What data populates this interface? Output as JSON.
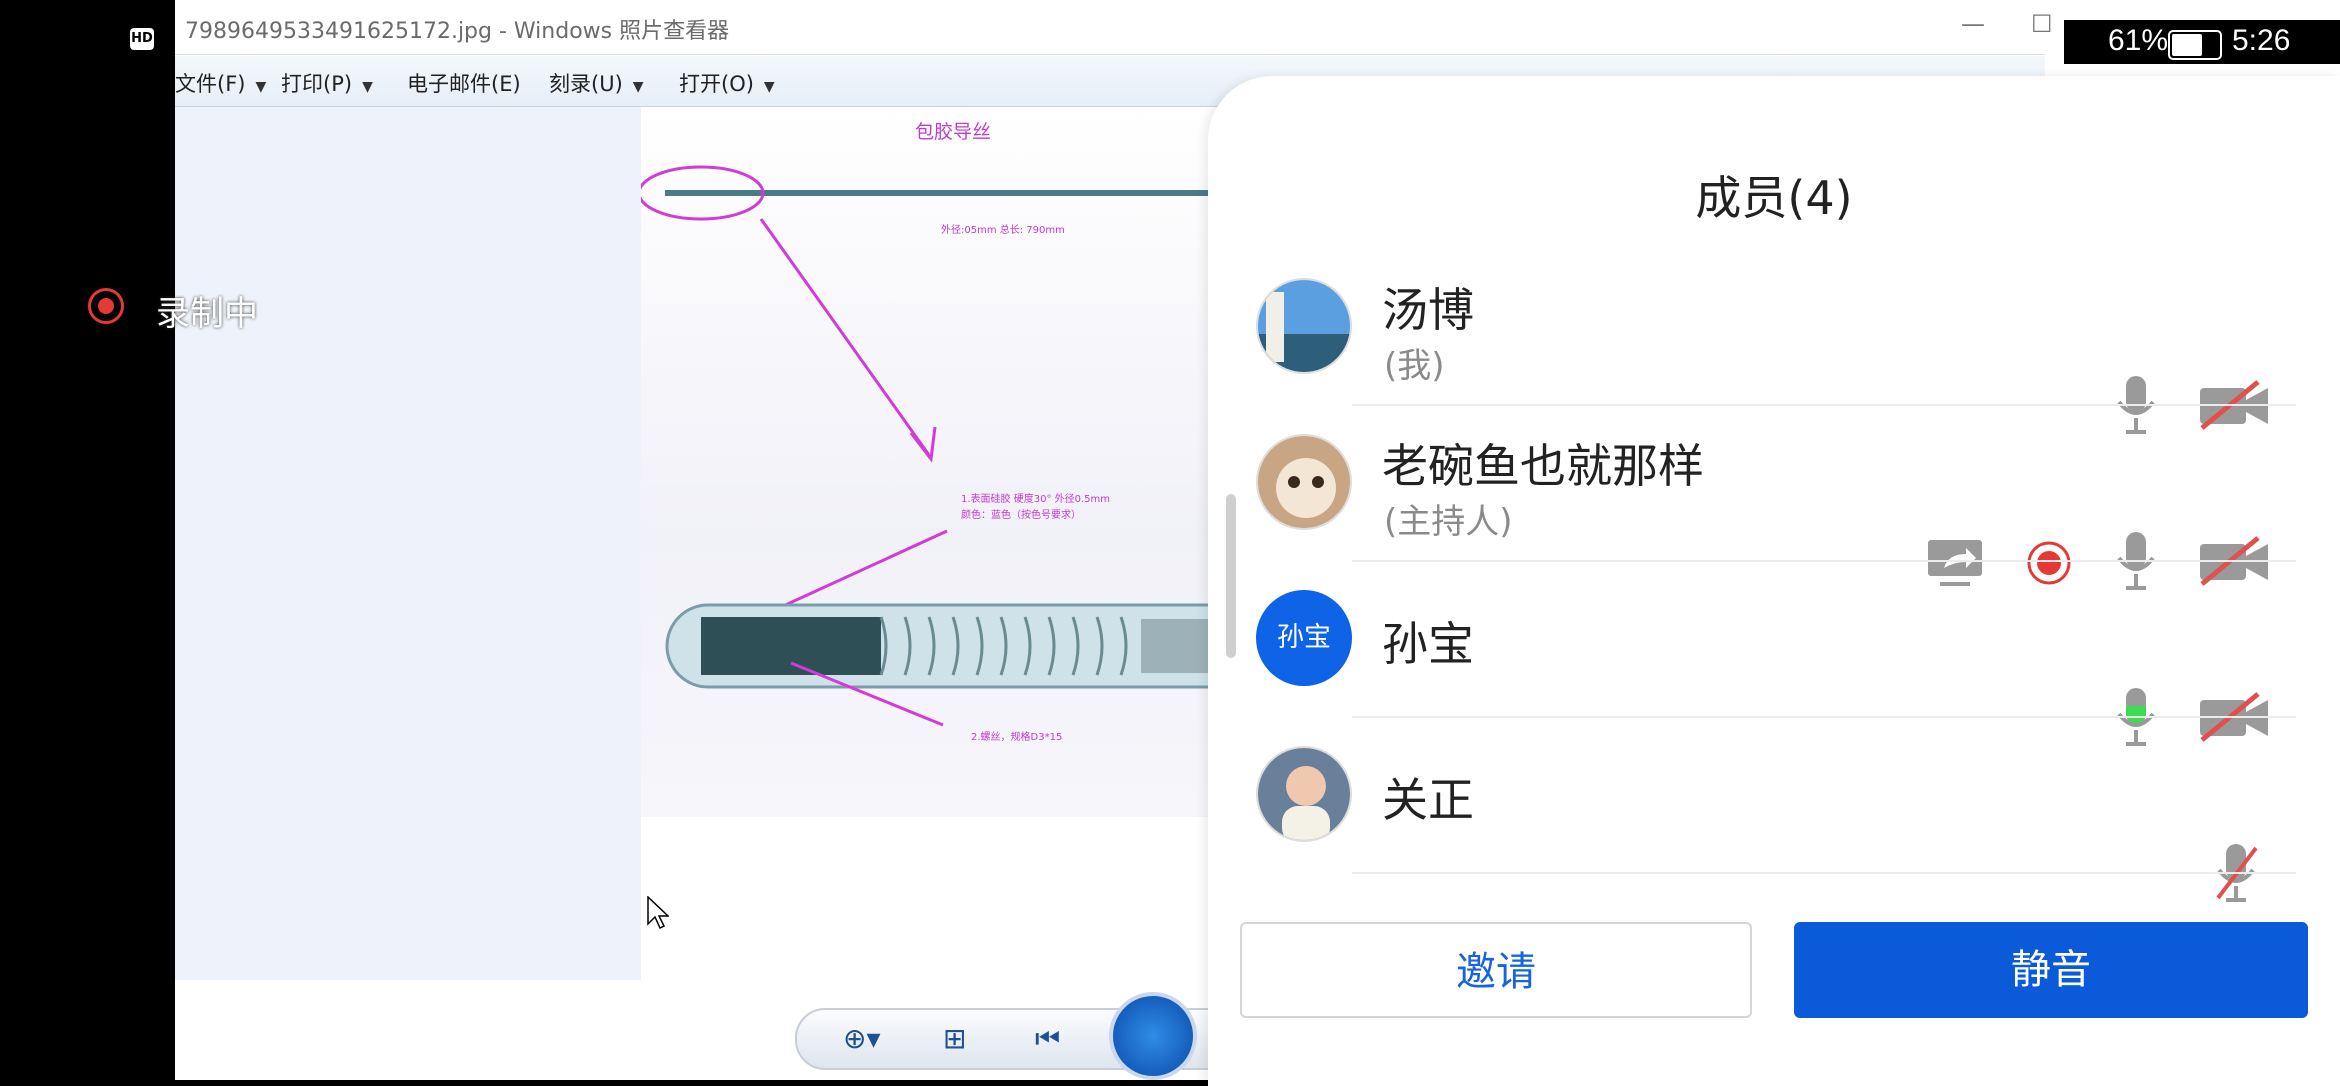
{
  "shared_screen": {
    "window_title": "7989649533491625172.jpg - Windows 照片查看器",
    "menu": [
      "文件(F)",
      "打印(P)",
      "电子邮件(E)",
      "刻录(U)",
      "打开(O)"
    ],
    "image": {
      "title": "包胶导丝",
      "spec": "外径:05mm  总长: 790mm",
      "note1_line1": "1.表面硅胶 硬度30° 外径0.5mm",
      "note1_line2": "颜色：蓝色（按色号要求）",
      "note2": "2.螺丝，规格D3*15"
    }
  },
  "status_bar": {
    "hd": "HD",
    "battery": "61%",
    "time": "5:26"
  },
  "recording": {
    "label": "录制中",
    "color": "#e53935"
  },
  "members_panel": {
    "title": "成员(4)",
    "members": [
      {
        "name": "汤博",
        "role": "(我)",
        "avatar": "photo-sea"
      },
      {
        "name": "老碗鱼也就那样",
        "role": "(主持人)",
        "avatar": "photo-cat"
      },
      {
        "name": "孙宝",
        "role": "",
        "avatar_text": "孙宝"
      },
      {
        "name": "关正",
        "role": "",
        "avatar": "photo-baby"
      }
    ],
    "invite_label": "邀请",
    "mute_label": "静音",
    "colors": {
      "accent": "#0b5ad9",
      "record_red": "#e53935",
      "mic_active": "#3ddc53"
    }
  }
}
